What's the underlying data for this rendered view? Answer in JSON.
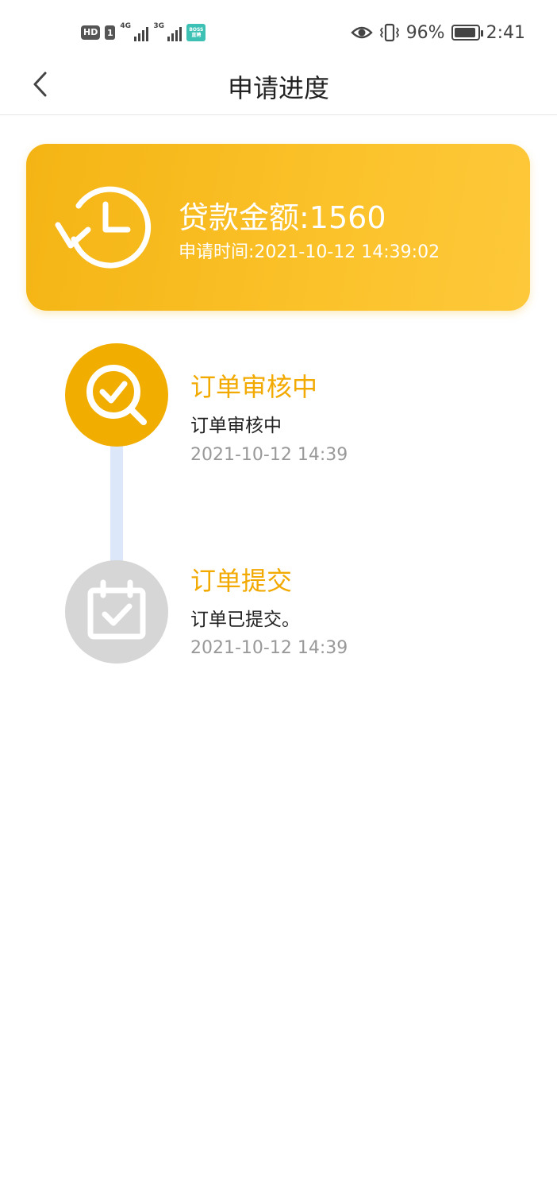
{
  "status_bar": {
    "hd_label": "HD",
    "sim_label": "1",
    "net1_label": "4G",
    "net2_label": "3G",
    "boss_label": "BOSS直聘",
    "battery_percent": "96%",
    "battery_level": 0.96,
    "time": "2:41"
  },
  "header": {
    "title": "申请进度"
  },
  "loan_card": {
    "amount_text": "贷款金额:1560",
    "apply_time_text": "申请时间:2021-10-12 14:39:02"
  },
  "timeline": [
    {
      "title": "订单审核中",
      "desc": "订单审核中",
      "time": "2021-10-12 14:39",
      "status": "active"
    },
    {
      "title": "订单提交",
      "desc": "订单已提交。",
      "time": "2021-10-12 14:39",
      "status": "done"
    }
  ],
  "colors": {
    "accent": "#f2ae00",
    "card_start": "#f4b414",
    "card_end": "#fdc83a",
    "inactive_circle": "#d6d6d6",
    "connector": "#dde7fa"
  }
}
